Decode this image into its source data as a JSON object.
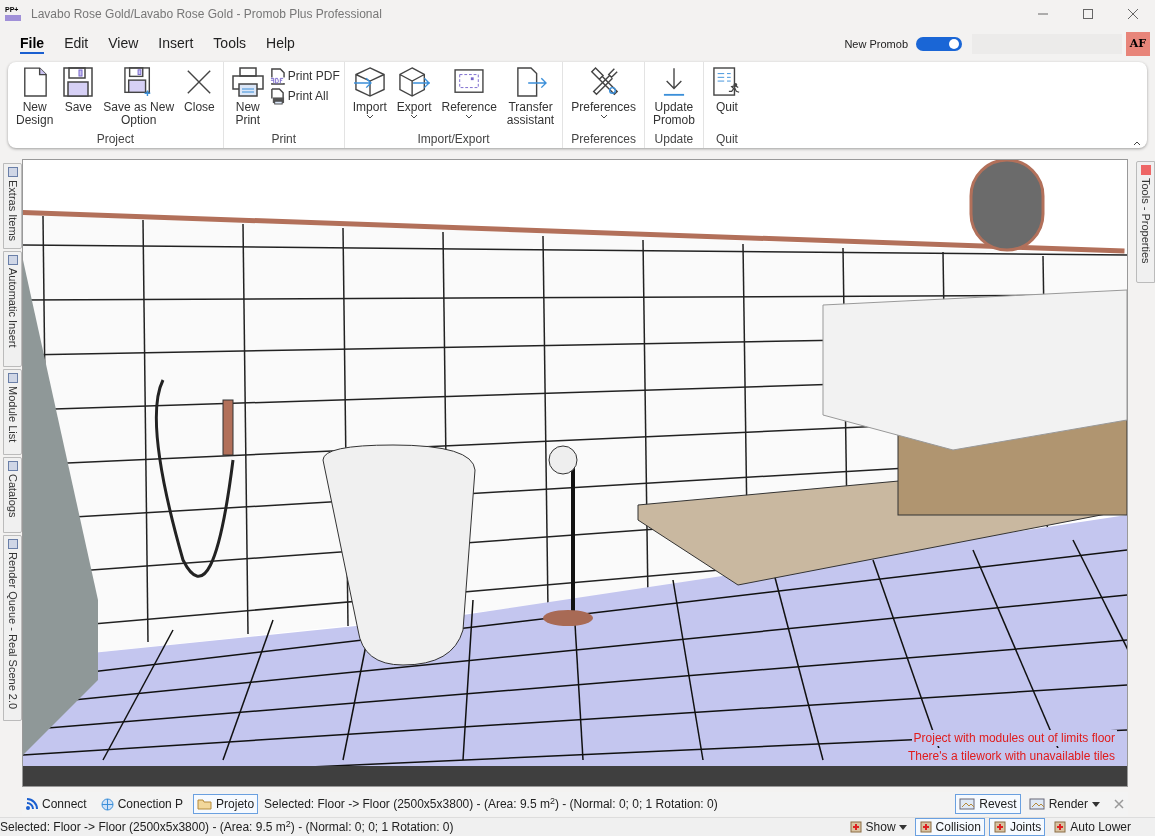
{
  "window": {
    "title": "Lavabo Rose Gold/Lavabo Rose Gold - Promob Plus Professional",
    "app_badge": "PP+"
  },
  "menu": [
    {
      "label": "File",
      "selected": true
    },
    {
      "label": "Edit",
      "selected": false
    },
    {
      "label": "View",
      "selected": false
    },
    {
      "label": "Insert",
      "selected": false
    },
    {
      "label": "Tools",
      "selected": false
    },
    {
      "label": "Help",
      "selected": false
    }
  ],
  "new_promob": {
    "label": "New Promob",
    "on": true
  },
  "user": {
    "initials": "AF"
  },
  "ribbon": [
    {
      "name": "Project",
      "buttons": [
        {
          "kind": "large",
          "lines": [
            "New",
            "Design"
          ],
          "dropdown": false
        },
        {
          "kind": "large",
          "lines": [
            "Save"
          ],
          "dropdown": false
        },
        {
          "kind": "large",
          "lines": [
            "Save as New",
            "Option"
          ],
          "dropdown": false
        },
        {
          "kind": "large",
          "lines": [
            "Close"
          ],
          "dropdown": false
        }
      ]
    },
    {
      "name": "Print",
      "buttons": [
        {
          "kind": "large",
          "lines": [
            "New",
            "Print"
          ],
          "dropdown": false
        },
        {
          "kind": "small",
          "lines": [
            "Print PDF"
          ],
          "dropdown": false
        },
        {
          "kind": "small",
          "lines": [
            "Print All"
          ],
          "dropdown": false
        }
      ]
    },
    {
      "name": "Import/Export",
      "buttons": [
        {
          "kind": "large",
          "lines": [
            "Import"
          ],
          "dropdown": true
        },
        {
          "kind": "large",
          "lines": [
            "Export"
          ],
          "dropdown": true
        },
        {
          "kind": "large",
          "lines": [
            "Reference"
          ],
          "dropdown": true
        },
        {
          "kind": "large",
          "lines": [
            "Transfer",
            "assistant"
          ],
          "dropdown": false
        }
      ]
    },
    {
      "name": "Preferences",
      "buttons": [
        {
          "kind": "large",
          "lines": [
            "Preferences"
          ],
          "dropdown": true
        }
      ]
    },
    {
      "name": "Update",
      "buttons": [
        {
          "kind": "large",
          "lines": [
            "Update",
            "Promob"
          ],
          "dropdown": false
        }
      ]
    },
    {
      "name": "Quit",
      "buttons": [
        {
          "kind": "large",
          "lines": [
            "Quit"
          ],
          "dropdown": false
        }
      ]
    }
  ],
  "left_tabs": [
    {
      "label": "Extras Items"
    },
    {
      "label": "Automatic Insert"
    },
    {
      "label": "Module List"
    },
    {
      "label": "Catalogs"
    },
    {
      "label": "Render Queue - Real Scene 2.0"
    }
  ],
  "right_tabs": [
    {
      "label": "Tools - Properties"
    }
  ],
  "viewport": {
    "warnings": [
      "Project with modules out of limits floor",
      "There's a tilework with unavailable tiles"
    ]
  },
  "toolbar": {
    "items": [
      {
        "label": "Connect",
        "selected": false
      },
      {
        "label": "Conection P",
        "selected": false
      },
      {
        "label": "Projeto",
        "selected": true
      }
    ],
    "selection_text": "Selected: Floor -> Floor (2500x5x3800) - (Area: 9.5 m$^{2}$) - (Normal: 0; 0; 1 Rotation: 0)",
    "right_items": [
      {
        "label": "Revest",
        "selected": true,
        "dropdown": false
      },
      {
        "label": "Render",
        "selected": false,
        "dropdown": true
      }
    ]
  },
  "status_bar": {
    "text": "Selected: Floor -> Floor (2500x5x3800) - (Area: 9.5 m$^{2}$) - (Normal: 0; 0; 1 Rotation: 0)",
    "toggles": [
      {
        "label": "Show",
        "on": false,
        "dropdown": true
      },
      {
        "label": "Collision",
        "on": true,
        "dropdown": false
      },
      {
        "label": "Joints",
        "on": true,
        "dropdown": false
      },
      {
        "label": "Auto Lower",
        "on": false,
        "dropdown": false
      }
    ]
  }
}
